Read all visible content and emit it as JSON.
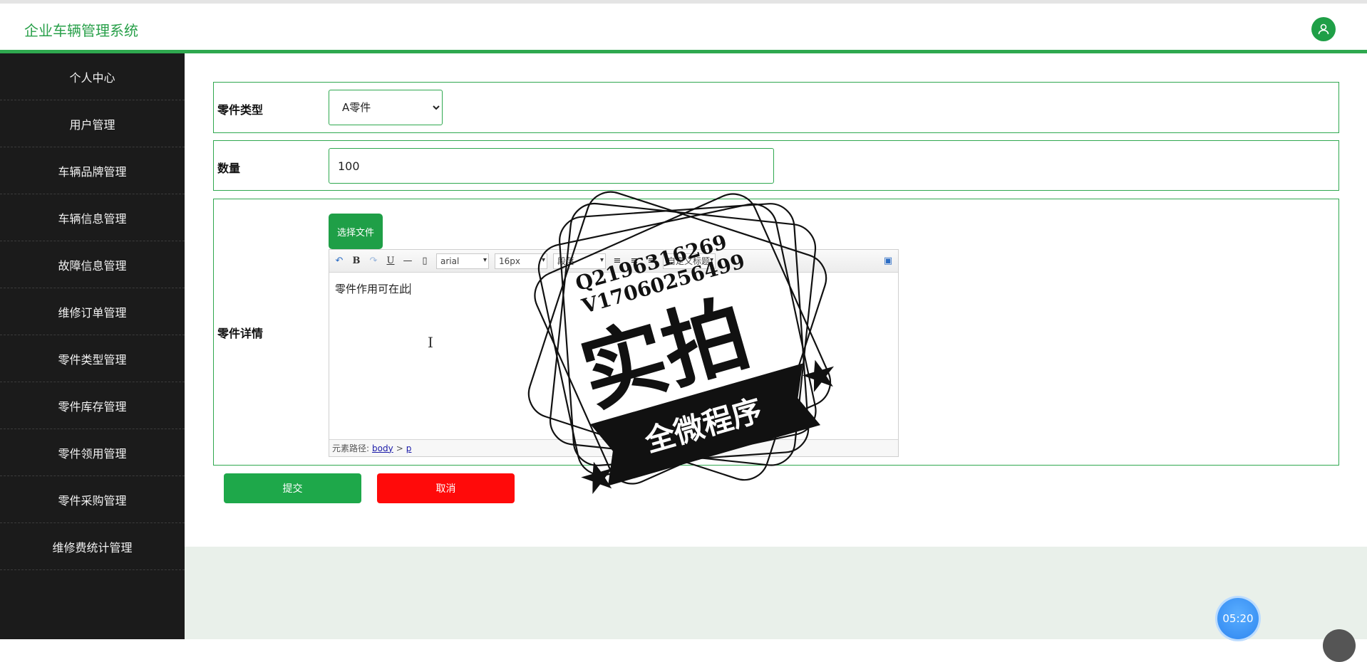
{
  "app": {
    "title": "企业车辆管理系统"
  },
  "icons": {
    "user": "user-icon"
  },
  "colors": {
    "accent": "#2fa84f",
    "sidebar_bg": "#1b1b1b",
    "submit": "#1ea84a",
    "cancel": "#ff0a0a"
  },
  "sidebar": {
    "items": [
      {
        "label": "个人中心"
      },
      {
        "label": "用户管理"
      },
      {
        "label": "车辆品牌管理"
      },
      {
        "label": "车辆信息管理"
      },
      {
        "label": "故障信息管理"
      },
      {
        "label": "维修订单管理"
      },
      {
        "label": "零件类型管理"
      },
      {
        "label": "零件库存管理"
      },
      {
        "label": "零件领用管理"
      },
      {
        "label": "零件采购管理"
      },
      {
        "label": "维修费统计管理"
      }
    ]
  },
  "form": {
    "type_label": "零件类型",
    "type_value": "A零件",
    "quantity_label": "数量",
    "quantity_value": "100",
    "detail_label": "零件详情",
    "file_button": "选择文件",
    "editor": {
      "font": "arial",
      "size": "16px",
      "paragraph": "段落",
      "custom_title": "自定义标题",
      "content": "零件作用可在此",
      "path_label": "元素路径:",
      "path_body": "body",
      "path_sep": ">",
      "path_p": "p"
    },
    "submit_label": "提交",
    "cancel_label": "取消"
  },
  "watermark": {
    "line1": "Q2196316269",
    "line2": "V17060256499",
    "big": "实拍",
    "ribbon": "全微程序"
  },
  "timer": {
    "value": "05:20"
  }
}
